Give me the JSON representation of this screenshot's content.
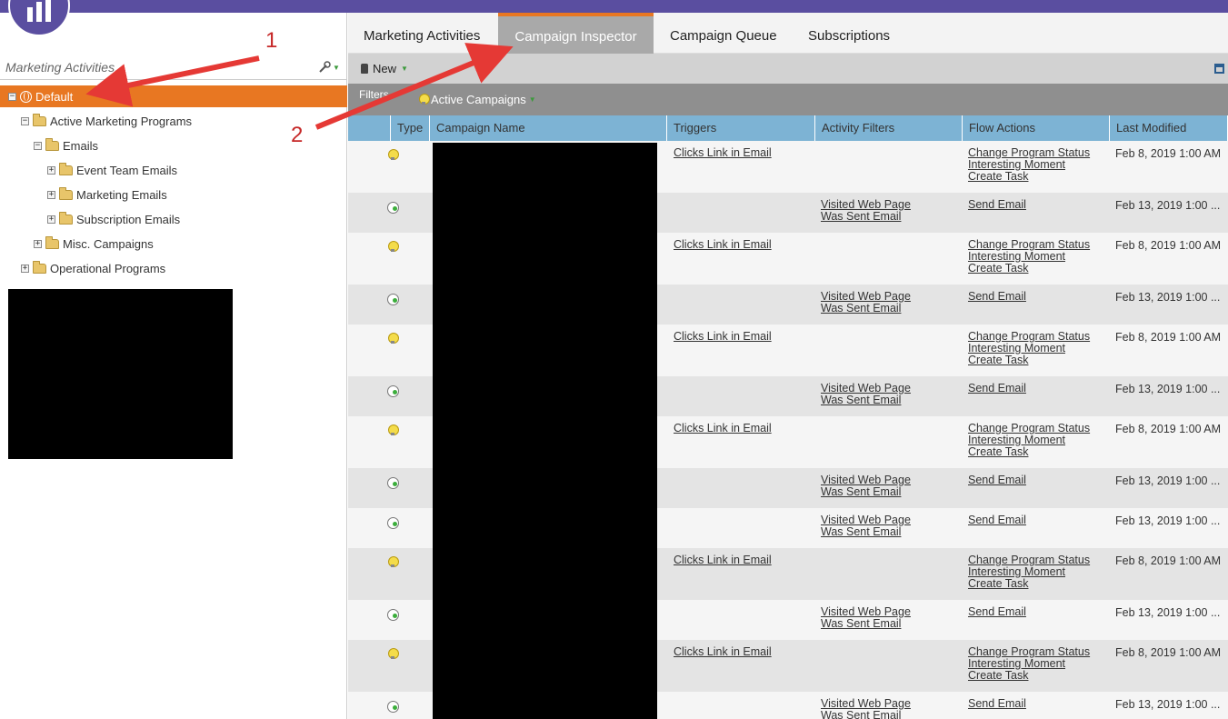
{
  "app": {
    "brand_color": "#5a4ea0",
    "accent_color": "#e87722"
  },
  "left_panel": {
    "search_placeholder": "Marketing Activities...",
    "tree": [
      {
        "label": "Default",
        "toggle": "−",
        "level": 0,
        "selected": true
      },
      {
        "label": "Active Marketing Programs",
        "toggle": "−",
        "level": 1
      },
      {
        "label": "Emails",
        "toggle": "−",
        "level": 2
      },
      {
        "label": "Event Team Emails",
        "toggle": "+",
        "level": 3
      },
      {
        "label": "Marketing Emails",
        "toggle": "+",
        "level": 3
      },
      {
        "label": "Subscription Emails",
        "toggle": "+",
        "level": 3
      },
      {
        "label": "Misc. Campaigns",
        "toggle": "+",
        "level": 2
      },
      {
        "label": "Operational Programs",
        "toggle": "+",
        "level": 1
      }
    ]
  },
  "tabs": [
    {
      "label": "Marketing Activities",
      "active": false
    },
    {
      "label": "Campaign Inspector",
      "active": true
    },
    {
      "label": "Campaign Queue",
      "active": false
    },
    {
      "label": "Subscriptions",
      "active": false
    }
  ],
  "toolbar": {
    "new_label": "New"
  },
  "filterbar": {
    "label": "Filters",
    "active_filter": "Active Campaigns"
  },
  "table": {
    "columns": [
      "Type",
      "Campaign Name",
      "Triggers",
      "Activity Filters",
      "Flow Actions",
      "Last Modified"
    ],
    "rows": [
      {
        "type": "bulb",
        "triggers": [
          "Clicks Link in Email"
        ],
        "filters": [],
        "actions": [
          "Change Program Status",
          "Interesting Moment",
          "Create Task"
        ],
        "modified": "Feb 8, 2019 1:00 AM"
      },
      {
        "type": "clock",
        "triggers": [],
        "filters": [
          "Visited Web Page",
          "Was Sent Email"
        ],
        "actions": [
          "Send Email"
        ],
        "modified": "Feb 13, 2019 1:00 ..."
      },
      {
        "type": "bulb",
        "triggers": [
          "Clicks Link in Email"
        ],
        "filters": [],
        "actions": [
          "Change Program Status",
          "Interesting Moment",
          "Create Task"
        ],
        "modified": "Feb 8, 2019 1:00 AM"
      },
      {
        "type": "clock",
        "triggers": [],
        "filters": [
          "Visited Web Page",
          "Was Sent Email"
        ],
        "actions": [
          "Send Email"
        ],
        "modified": "Feb 13, 2019 1:00 ..."
      },
      {
        "type": "bulb",
        "triggers": [
          "Clicks Link in Email"
        ],
        "filters": [],
        "actions": [
          "Change Program Status",
          "Interesting Moment",
          "Create Task"
        ],
        "modified": "Feb 8, 2019 1:00 AM"
      },
      {
        "type": "clock",
        "triggers": [],
        "filters": [
          "Visited Web Page",
          "Was Sent Email"
        ],
        "actions": [
          "Send Email"
        ],
        "modified": "Feb 13, 2019 1:00 ..."
      },
      {
        "type": "bulb",
        "triggers": [
          "Clicks Link in Email"
        ],
        "filters": [],
        "actions": [
          "Change Program Status",
          "Interesting Moment",
          "Create Task"
        ],
        "modified": "Feb 8, 2019 1:00 AM"
      },
      {
        "type": "clock",
        "triggers": [],
        "filters": [
          "Visited Web Page",
          "Was Sent Email"
        ],
        "actions": [
          "Send Email"
        ],
        "modified": "Feb 13, 2019 1:00 ..."
      },
      {
        "type": "clock",
        "triggers": [],
        "filters": [
          "Visited Web Page",
          "Was Sent Email"
        ],
        "actions": [
          "Send Email"
        ],
        "modified": "Feb 13, 2019 1:00 ..."
      },
      {
        "type": "bulb",
        "triggers": [
          "Clicks Link in Email"
        ],
        "filters": [],
        "actions": [
          "Change Program Status",
          "Interesting Moment",
          "Create Task"
        ],
        "modified": "Feb 8, 2019 1:00 AM"
      },
      {
        "type": "clock",
        "triggers": [],
        "filters": [
          "Visited Web Page",
          "Was Sent Email"
        ],
        "actions": [
          "Send Email"
        ],
        "modified": "Feb 13, 2019 1:00 ..."
      },
      {
        "type": "bulb",
        "triggers": [
          "Clicks Link in Email"
        ],
        "filters": [],
        "actions": [
          "Change Program Status",
          "Interesting Moment",
          "Create Task"
        ],
        "modified": "Feb 8, 2019 1:00 AM"
      },
      {
        "type": "clock",
        "triggers": [],
        "filters": [
          "Visited Web Page",
          "Was Sent Email"
        ],
        "actions": [
          "Send Email"
        ],
        "modified": "Feb 13, 2019 1:00 ..."
      }
    ]
  },
  "annotations": {
    "label_1": "1",
    "label_2": "2",
    "color": "#e53935"
  }
}
